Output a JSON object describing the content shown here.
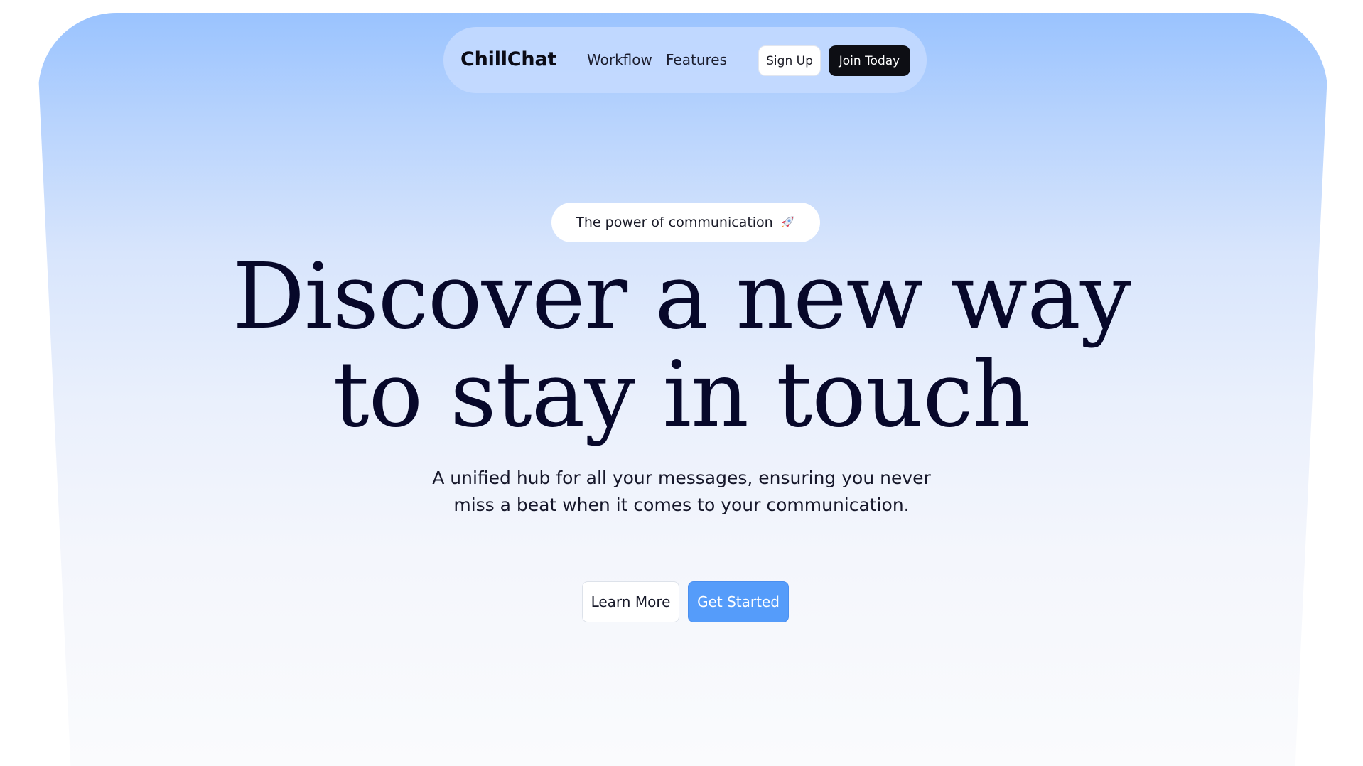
{
  "nav": {
    "brand": "ChillChat",
    "links": [
      "Workflow",
      "Features"
    ],
    "signup_label": "Sign Up",
    "join_label": "Join Today"
  },
  "hero": {
    "tagline": "The power of communication",
    "tagline_icon": "rocket-icon",
    "headline_lines": [
      "Discover a new way",
      "to stay in touch"
    ],
    "subtitle_lines": [
      "A unified hub for all your messages, ensuring you never",
      "miss a beat when it comes to your communication."
    ],
    "learn_more_label": "Learn More",
    "get_started_label": "Get Started"
  },
  "colors": {
    "hero_gradient_top": "#9ac3fe",
    "hero_gradient_bottom": "#fafbfd",
    "headline": "#07082a",
    "primary_button": "#559cfa",
    "dark_button": "#0d0e14"
  }
}
